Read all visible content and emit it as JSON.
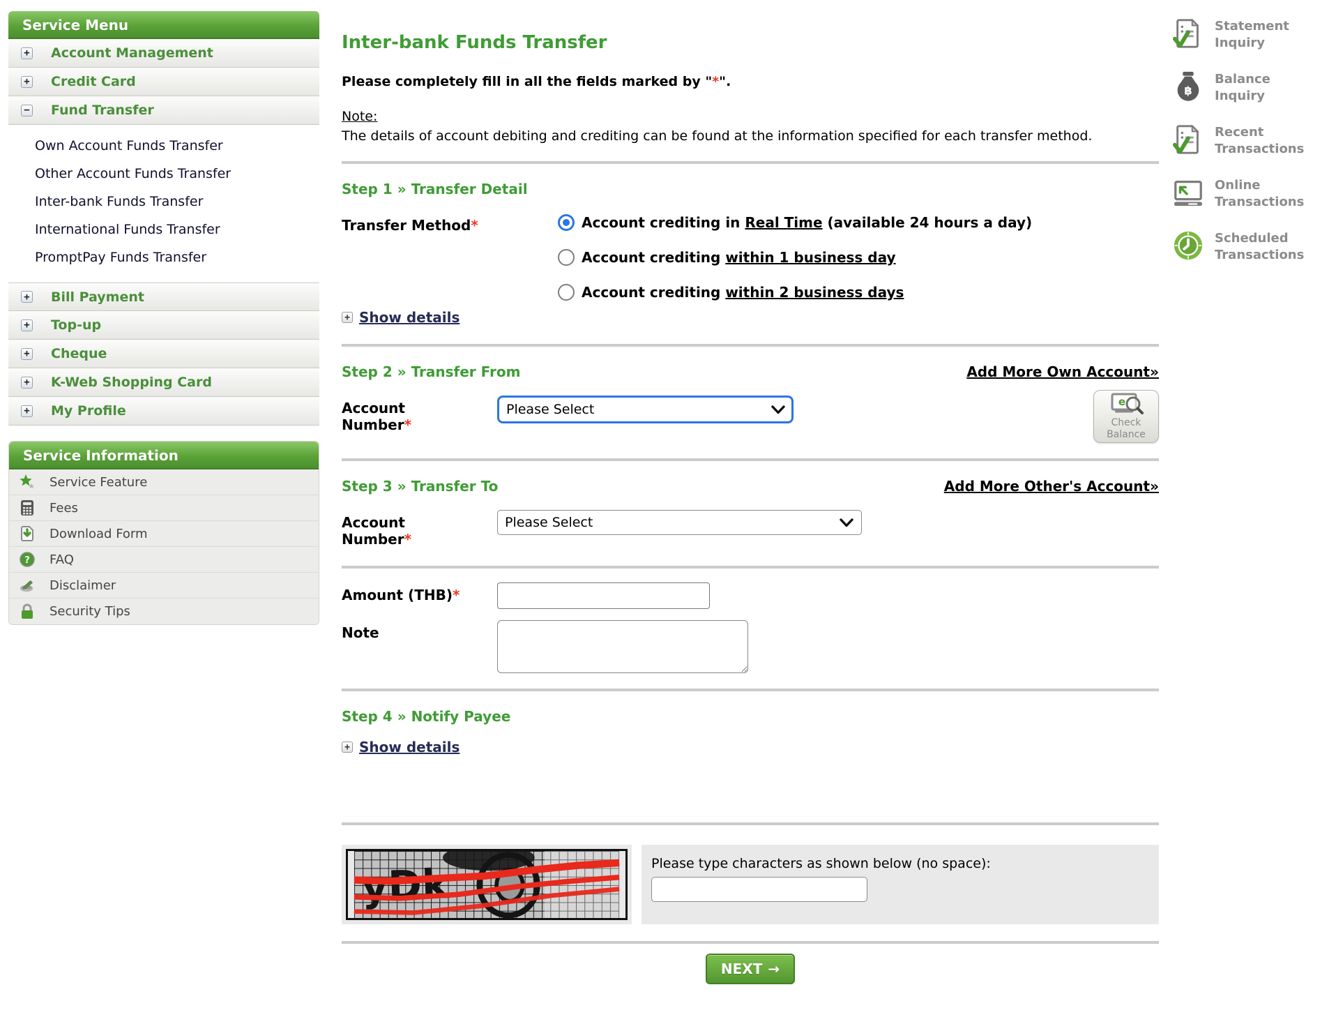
{
  "colors": {
    "accent_green": "#4a8f3a",
    "step_green": "#3f9c35",
    "alert_red": "#ee3524",
    "link_navy": "#272c55",
    "radio_blue": "#2b76e3"
  },
  "sidebar": {
    "menu_header": "Service Menu",
    "menu_items": [
      {
        "label": "Account Management",
        "state": "collapsed"
      },
      {
        "label": "Credit Card",
        "state": "collapsed"
      },
      {
        "label": "Fund Transfer",
        "state": "expanded"
      },
      {
        "label": "Bill Payment",
        "state": "collapsed"
      },
      {
        "label": "Top-up",
        "state": "collapsed"
      },
      {
        "label": "Cheque",
        "state": "collapsed"
      },
      {
        "label": "K-Web Shopping Card",
        "state": "collapsed"
      },
      {
        "label": "My Profile",
        "state": "collapsed"
      }
    ],
    "sub_items": [
      "Own Account Funds Transfer",
      "Other Account Funds Transfer",
      "Inter-bank Funds Transfer",
      "International Funds Transfer",
      "PromptPay Funds Transfer"
    ],
    "info_header": "Service Information",
    "info_items": [
      {
        "label": "Service Feature",
        "icon": "star-icon"
      },
      {
        "label": "Fees",
        "icon": "calculator-icon"
      },
      {
        "label": "Download Form",
        "icon": "download-icon"
      },
      {
        "label": "FAQ",
        "icon": "question-icon"
      },
      {
        "label": "Disclaimer",
        "icon": "disclaimer-icon"
      },
      {
        "label": "Security Tips",
        "icon": "lock-icon"
      }
    ]
  },
  "main": {
    "title": "Inter-bank Funds Transfer",
    "required_mark": "*",
    "instruction": {
      "part1": "Please completely fill in all the fields marked by \"",
      "star": "*",
      "part2": "\"."
    },
    "note_label": "Note:",
    "note_text": "The details of account debiting and crediting can be found at the information specified for each transfer method.",
    "step1": {
      "heading": "Step 1 » Transfer Detail",
      "label": "Transfer Method",
      "options": [
        {
          "pre": "Account crediting in ",
          "underlined": "Real Time",
          "post": " (available 24 hours a day)",
          "selected": true
        },
        {
          "pre": "Account crediting ",
          "underlined": "within 1 business day",
          "post": "",
          "selected": false
        },
        {
          "pre": "Account crediting ",
          "underlined": "within 2 business days",
          "post": "",
          "selected": false
        }
      ],
      "show_details": "Show details"
    },
    "step2": {
      "heading": "Step 2 » Transfer From",
      "add_link": "Add More Own Account»",
      "account_label": "Account Number",
      "select_value": "Please Select",
      "check_balance_line1": "Check",
      "check_balance_line2": "Balance"
    },
    "step3": {
      "heading": "Step 3 » Transfer To",
      "add_link": "Add More Other's Account»",
      "account_label": "Account Number",
      "select_value": "Please Select"
    },
    "amount": {
      "label": "Amount (THB)",
      "value": ""
    },
    "note_field": {
      "label": "Note",
      "value": ""
    },
    "step4": {
      "heading": "Step 4 » Notify Payee",
      "show_details": "Show details"
    },
    "captcha": {
      "prompt": "Please type characters as shown below (no space):",
      "visible_text": "yDk",
      "input_value": ""
    },
    "next_label": "NEXT",
    "next_arrow": "→"
  },
  "quick_links": [
    {
      "line1": "Statement",
      "line2": "Inquiry",
      "icon": "statement-inquiry-icon"
    },
    {
      "line1": "Balance",
      "line2": "Inquiry",
      "icon": "balance-inquiry-icon"
    },
    {
      "line1": "Recent",
      "line2": "Transactions",
      "icon": "recent-transactions-icon"
    },
    {
      "line1": "Online",
      "line2": "Transactions",
      "icon": "online-transactions-icon"
    },
    {
      "line1": "Scheduled",
      "line2": "Transactions",
      "icon": "scheduled-transactions-icon"
    }
  ]
}
